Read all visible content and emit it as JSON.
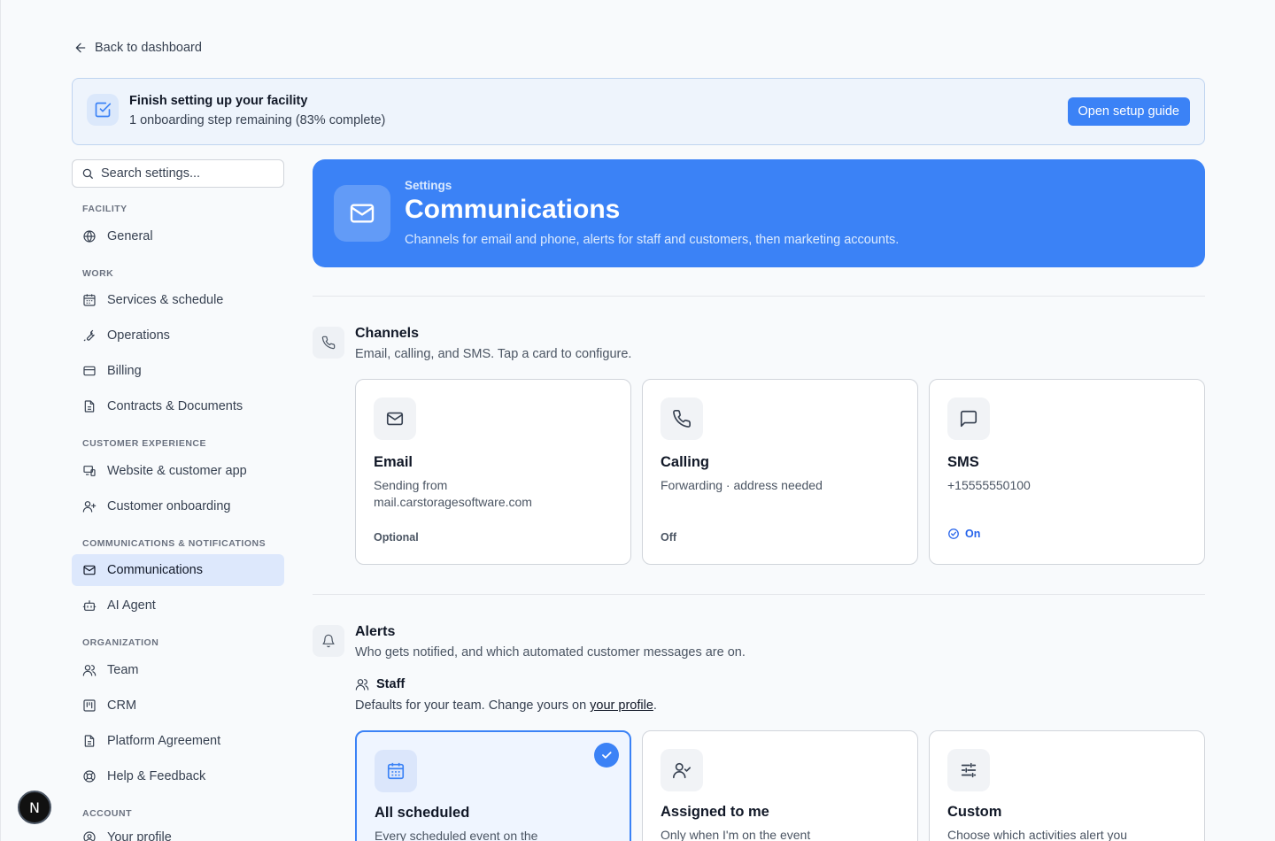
{
  "back_link": {
    "label": "Back to dashboard"
  },
  "setup": {
    "title": "Finish setting up your facility",
    "subtitle": "1 onboarding step remaining (83% complete)",
    "progress_percent": 83,
    "button": "Open setup guide"
  },
  "search": {
    "placeholder": "Search settings..."
  },
  "sidebar": {
    "sections": [
      {
        "label": "FACILITY",
        "items": [
          {
            "label": "General",
            "icon": "globe-icon"
          }
        ]
      },
      {
        "label": "WORK",
        "items": [
          {
            "label": "Services & schedule",
            "icon": "calendar-icon"
          },
          {
            "label": "Operations",
            "icon": "wrench-icon"
          },
          {
            "label": "Billing",
            "icon": "credit-card-icon"
          },
          {
            "label": "Contracts & Documents",
            "icon": "document-icon"
          }
        ]
      },
      {
        "label": "CUSTOMER EXPERIENCE",
        "items": [
          {
            "label": "Website & customer app",
            "icon": "devices-icon"
          },
          {
            "label": "Customer onboarding",
            "icon": "user-plus-icon"
          }
        ]
      },
      {
        "label": "COMMUNICATIONS & NOTIFICATIONS",
        "items": [
          {
            "label": "Communications",
            "icon": "mail-icon",
            "active": true
          },
          {
            "label": "AI Agent",
            "icon": "bot-icon"
          }
        ]
      },
      {
        "label": "ORGANIZATION",
        "items": [
          {
            "label": "Team",
            "icon": "users-icon"
          },
          {
            "label": "CRM",
            "icon": "kanban-icon"
          },
          {
            "label": "Platform Agreement",
            "icon": "document-icon"
          },
          {
            "label": "Help & Feedback",
            "icon": "lifebuoy-icon"
          }
        ]
      },
      {
        "label": "ACCOUNT",
        "items": [
          {
            "label": "Your profile",
            "icon": "user-circle-icon"
          }
        ]
      }
    ]
  },
  "hero": {
    "eyebrow": "Settings",
    "title": "Communications",
    "description": "Channels for email and phone, alerts for staff and customers, then marketing accounts.",
    "color": "#3b82f6"
  },
  "channels": {
    "title": "Channels",
    "description": "Email, calling, and SMS. Tap a card to configure.",
    "cards": [
      {
        "title": "Email",
        "desc": "Sending from mail.carstoragesoftware.com",
        "status": "Optional",
        "icon": "mail-icon"
      },
      {
        "title": "Calling",
        "desc": "Forwarding · address needed",
        "status": "Off",
        "icon": "phone-icon"
      },
      {
        "title": "SMS",
        "desc": "+15555550100",
        "status": "On",
        "icon": "message-icon"
      }
    ]
  },
  "alerts": {
    "title": "Alerts",
    "description": "Who gets notified, and which automated customer messages are on.",
    "staff_label": "Staff",
    "staff_desc_prefix": "Defaults for your team. Change yours on ",
    "staff_desc_link": "your profile",
    "staff_desc_suffix": ".",
    "cards": [
      {
        "title": "All scheduled",
        "desc": "Every scheduled event on the",
        "selected": true,
        "icon": "calendar-grid-icon"
      },
      {
        "title": "Assigned to me",
        "desc": "Only when I'm on the event",
        "selected": false,
        "icon": "user-check-icon"
      },
      {
        "title": "Custom",
        "desc": "Choose which activities alert you",
        "selected": false,
        "icon": "sliders-icon"
      }
    ]
  },
  "avatar_badge": {
    "letter": "N"
  }
}
